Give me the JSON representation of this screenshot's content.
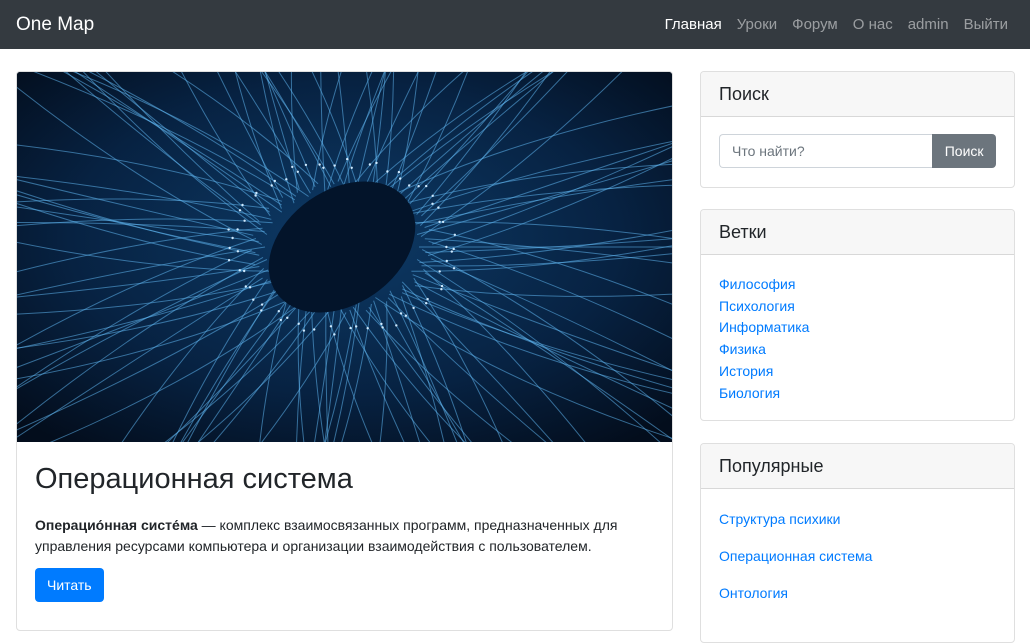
{
  "navbar": {
    "brand": "One Map",
    "links": [
      "Главная",
      "Уроки",
      "Форум",
      "О нас",
      "admin",
      "Выйти"
    ]
  },
  "post": {
    "title": "Операционная система",
    "text_bold": "Операцио́нная систе́ма",
    "text_rest": " — комплекс взаимосвязанных программ, предназначенных для управления ресурсами компьютера и организации взаимодействия с пользователем.",
    "read_button": "Читать"
  },
  "search": {
    "header": "Поиск",
    "placeholder": "Что найти?",
    "button": "Поиск"
  },
  "categories": {
    "header": "Ветки",
    "items": [
      "Философия",
      "Психология",
      "Информатика",
      "Физика",
      "История",
      "Биология"
    ]
  },
  "popular": {
    "header": "Популярные",
    "items": [
      "Структура психики",
      "Операционная система",
      "Онтология"
    ]
  },
  "colors": {
    "navbar": "#343a40",
    "primary": "#007bff",
    "secondary": "#6c757d"
  }
}
